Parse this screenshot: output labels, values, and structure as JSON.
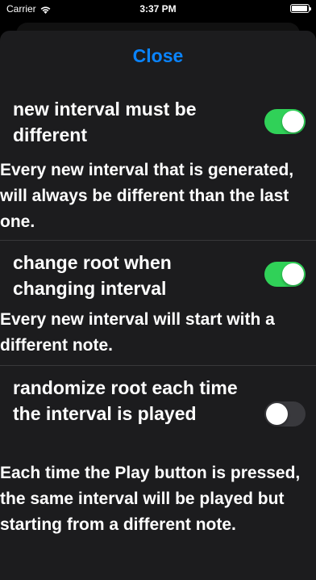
{
  "status_bar": {
    "carrier": "Carrier",
    "time": "3:37 PM"
  },
  "sheet": {
    "close_label": "Close"
  },
  "settings": [
    {
      "label": "new interval must be different",
      "enabled": true,
      "description": "Every new interval that is generated, will always be different than the last one."
    },
    {
      "label": "change root when changing interval",
      "enabled": true,
      "description": "Every new interval will start with a different note."
    },
    {
      "label": "randomize root each time the interval is played",
      "enabled": false,
      "description": "Each time the Play button is pressed, the same interval will be played but starting from a different note."
    }
  ],
  "colors": {
    "accent": "#0a84ff",
    "toggle_on": "#30d158",
    "toggle_off": "#39393d",
    "sheet_background": "#1c1c1e"
  }
}
